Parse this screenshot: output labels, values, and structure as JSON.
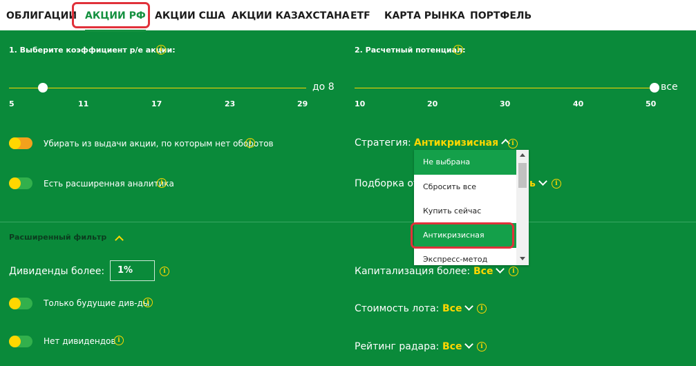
{
  "nav": {
    "tabs": [
      "ОБЛИГАЦИИ",
      "АКЦИИ РФ",
      "АКЦИИ США",
      "АКЦИИ КАЗАХСТАНА",
      "ETF",
      "КАРТА РЫНКА",
      "ПОРТФЕЛЬ"
    ],
    "active_tab": "АКЦИИ РФ"
  },
  "pe": {
    "title": "1. Выберите коэффициент p/e акции:",
    "value_label": "до 8",
    "ticks": [
      "5",
      "11",
      "17",
      "23",
      "29"
    ]
  },
  "potential": {
    "title": "2. Расчетный потенциал:",
    "value_label": "все",
    "ticks": [
      "10",
      "20",
      "30",
      "40",
      "50"
    ]
  },
  "toggles": {
    "no_turnover": "Убирать из выдачи акции, по которым нет оборотов",
    "extended_analytics": "Есть расширенная аналитика",
    "future_dividends": "Только будущие див-ды",
    "no_dividends": "Нет дивидендов"
  },
  "strategy": {
    "label": "Стратегия:",
    "value": "Антикризисная",
    "options": [
      "Не выбрана",
      "Сбросить все",
      "Купить сейчас",
      "Антикризисная",
      "Экспресс-метод Баффета"
    ],
    "selected": "Антикризисная"
  },
  "selection": {
    "label": "Подборка от"
  },
  "extended_filter": {
    "title": "Расширенный фильтр"
  },
  "dividends": {
    "label": "Дивиденды более:",
    "value": "1%"
  },
  "capitalization": {
    "label": "Капитализация более:",
    "value": "Все"
  },
  "lot_cost": {
    "label": "Стоимость лота:",
    "value": "Все"
  },
  "radar_rating": {
    "label": "Рейтинг радара:",
    "value": "Все"
  },
  "colors": {
    "background": "#0a8a3a",
    "accent": "#ffd700",
    "active_tab": "#14903f",
    "highlight": "#e0313a"
  }
}
